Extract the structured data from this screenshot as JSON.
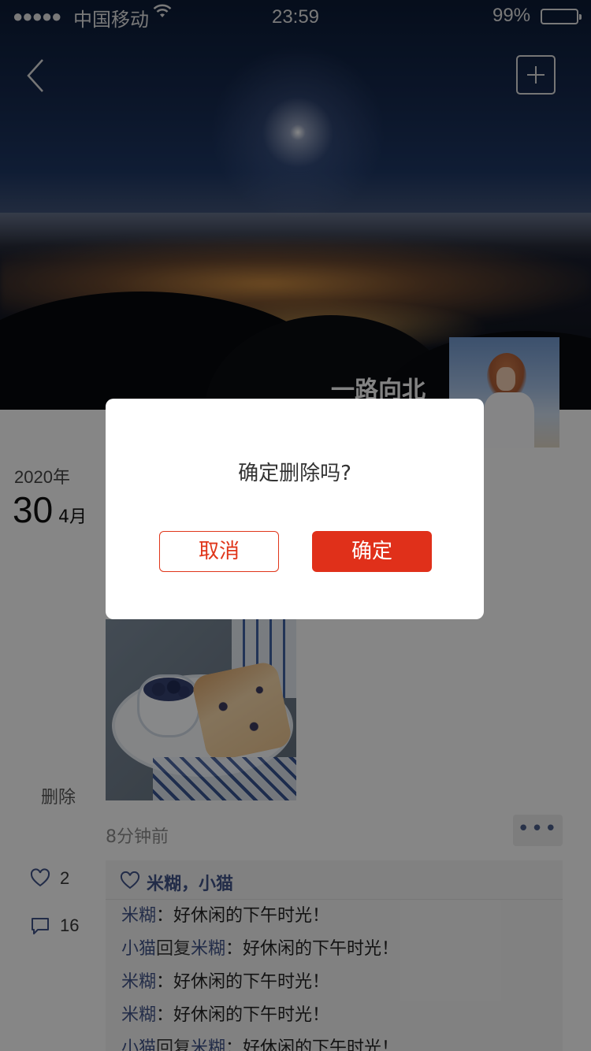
{
  "status_bar": {
    "signal": "●●●●●",
    "carrier": "中国移动",
    "time": "23:59",
    "battery_percent": "99%",
    "battery_level": 0.99
  },
  "header": {
    "back_icon": "chevron-left-icon",
    "add_icon": "plus-square-icon",
    "username": "一路向北"
  },
  "post": {
    "year": "2020年",
    "day": "30",
    "month": "4月",
    "delete_label": "删除",
    "time_ago": "8分钟前",
    "more_label": "•••",
    "like_count": "2",
    "comment_count": "16",
    "liked_by": "米糊，小猫",
    "comments": [
      {
        "author": "米糊",
        "reply_to": "",
        "text": "：好休闲的下午时光！"
      },
      {
        "author": "小猫",
        "reply_to": "米糊",
        "text": "：好休闲的下午时光！"
      },
      {
        "author": "米糊",
        "reply_to": "",
        "text": "：好休闲的下午时光！"
      },
      {
        "author": "米糊",
        "reply_to": "",
        "text": "：好休闲的下午时光！"
      },
      {
        "author": "小猫",
        "reply_to": "米糊",
        "text": "：好休闲的下午时光！"
      }
    ],
    "reply_word": "回复"
  },
  "dialog": {
    "message": "确定删除吗?",
    "cancel_label": "取消",
    "confirm_label": "确定"
  },
  "colors": {
    "accent": "#e0301a",
    "link": "#3f5184"
  }
}
